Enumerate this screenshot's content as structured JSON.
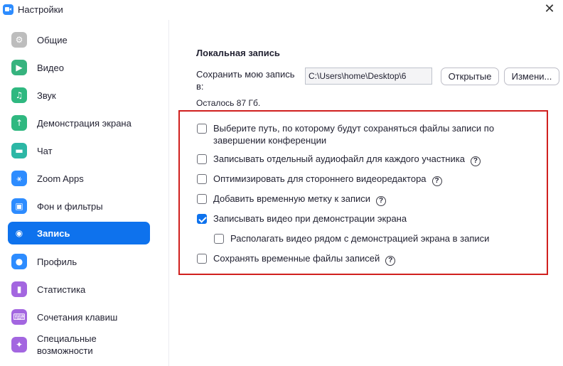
{
  "window": {
    "title": "Настройки",
    "close_glyph": "✕"
  },
  "sidebar": {
    "items": [
      {
        "label": "Общие",
        "icon": "gear-icon",
        "color": "#bdbdbd",
        "glyph": "⚙"
      },
      {
        "label": "Видео",
        "icon": "video-icon",
        "color": "#36b37e",
        "glyph": "▶"
      },
      {
        "label": "Звук",
        "icon": "headphones-icon",
        "color": "#2fb880",
        "glyph": "♫"
      },
      {
        "label": "Демонстрация экрана",
        "icon": "share-screen-icon",
        "color": "#2fb880",
        "glyph": "↑"
      },
      {
        "label": "Чат",
        "icon": "chat-icon",
        "color": "#2cb7a5",
        "glyph": "▬"
      },
      {
        "label": "Zoom Apps",
        "icon": "apps-icon",
        "color": "#2d8cff",
        "glyph": "⚹"
      },
      {
        "label": "Фон и фильтры",
        "icon": "background-icon",
        "color": "#2d8cff",
        "glyph": "▣"
      },
      {
        "label": "Запись",
        "icon": "record-icon",
        "color": "#0e72ed",
        "glyph": "◉"
      },
      {
        "label": "Профиль",
        "icon": "profile-icon",
        "color": "#2d8cff",
        "glyph": "●"
      },
      {
        "label": "Статистика",
        "icon": "statistics-icon",
        "color": "#a366e0",
        "glyph": "▮"
      },
      {
        "label": "Сочетания клавиш",
        "icon": "keyboard-icon",
        "color": "#a366e0",
        "glyph": "⌨"
      },
      {
        "label": "Специальные возможности",
        "icon": "accessibility-icon",
        "color": "#a366e0",
        "glyph": "✦"
      }
    ],
    "active_index": 7
  },
  "main": {
    "section_title": "Локальная запись",
    "save_label": "Сохранить мою запись в:",
    "path_value": "C:\\Users\\home\\Desktop\\6",
    "open_button": "Открытые",
    "change_button": "Измени...",
    "remaining": "Осталось 87 Гб.",
    "options": [
      {
        "label": "Выберите путь, по которому будут сохраняться файлы записи по завершении конференции",
        "checked": false,
        "help": false
      },
      {
        "label": "Записывать отдельный аудиофайл для каждого участника",
        "checked": false,
        "help": true
      },
      {
        "label": "Оптимизировать для стороннего видеоредактора",
        "checked": false,
        "help": true
      },
      {
        "label": "Добавить временную метку к записи",
        "checked": false,
        "help": true
      },
      {
        "label": "Записывать видео при демонстрации экрана",
        "checked": true,
        "help": false
      },
      {
        "label": "Располагать видео рядом с демонстрацией экрана в записи",
        "checked": false,
        "help": false
      },
      {
        "label": "Сохранять временные файлы записей",
        "checked": false,
        "help": true
      }
    ],
    "help_glyph": "?",
    "highlight_color": "#d0201e"
  }
}
